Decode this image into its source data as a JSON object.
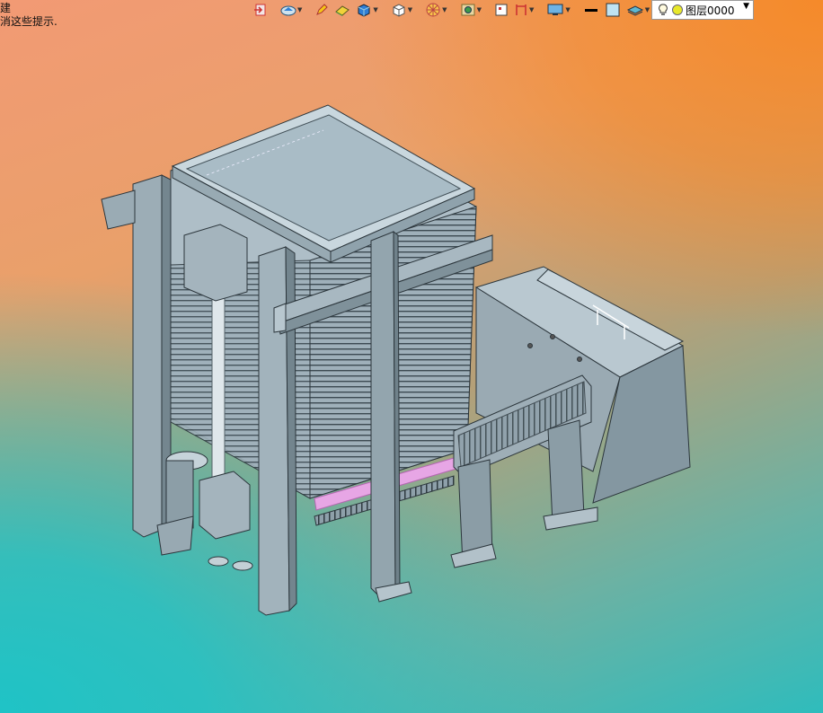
{
  "hints": {
    "line1": "建",
    "line2": "消这些提示."
  },
  "toolbar": {
    "buttons": [
      {
        "name": "exit-icon",
        "caret": false
      },
      {
        "name": "view-orient-icon",
        "caret": true
      },
      {
        "name": "pen-icon",
        "caret": false
      },
      {
        "name": "eraser-icon",
        "caret": false
      },
      {
        "name": "cube-shaded-icon",
        "caret": true
      },
      {
        "name": "cube-outline-icon",
        "caret": true
      },
      {
        "name": "wheel-icon",
        "caret": true
      },
      {
        "name": "frame-icon",
        "caret": true
      },
      {
        "name": "square-icon",
        "caret": false
      },
      {
        "name": "caliper-icon",
        "caret": true
      },
      {
        "name": "monitor-icon",
        "caret": true
      }
    ],
    "colors": {
      "line": "#000000",
      "fill": "#bfe3f2",
      "accent_blue": "#2f7fd6",
      "accent_yellow": "#f5c518",
      "accent_red": "#d8342c"
    }
  },
  "layer": {
    "name": "图层0000",
    "bulb_icon": "bulb-icon",
    "status_icon": "circle-icon"
  },
  "scene": {
    "background_colors": [
      "#f29a74",
      "#f58a2a",
      "#1fc3c6"
    ],
    "model_color": "#a6b8c2"
  }
}
